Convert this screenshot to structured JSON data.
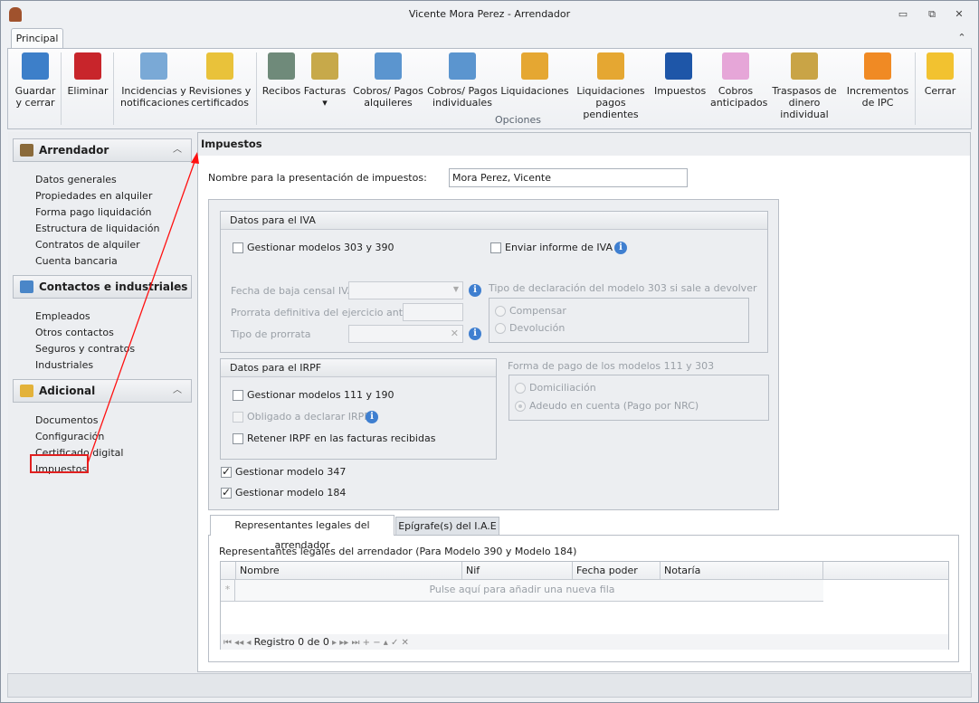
{
  "window": {
    "title": "Vicente Mora Perez - Arrendador",
    "minimize": "▭",
    "restore": "⧉",
    "close": "✕",
    "collapse": "⌃"
  },
  "ribbon": {
    "tab": "Principal",
    "group_label": "Opciones",
    "buttons": [
      {
        "l1": "Guardar",
        "l2": "y cerrar",
        "icon": "save-icon",
        "color": "#3d7fc9"
      },
      {
        "l1": "Eliminar",
        "l2": "",
        "icon": "delete-icon",
        "color": "#c8252b"
      },
      {
        "l1": "Incidencias y",
        "l2": "notificaciones",
        "icon": "incidents-icon",
        "color": "#7aa9d6"
      },
      {
        "l1": "Revisiones y",
        "l2": "certificados",
        "icon": "bell-icon",
        "color": "#e9c23a"
      },
      {
        "l1": "Recibos",
        "l2": "",
        "icon": "receipt-icon",
        "color": "#6f8a7a"
      },
      {
        "l1": "Facturas",
        "l2": "▾",
        "icon": "invoice-icon",
        "color": "#c7a94a"
      },
      {
        "l1": "Cobros/ Pagos",
        "l2": "alquileres",
        "icon": "calculator-icon",
        "color": "#5b95cf"
      },
      {
        "l1": "Cobros/ Pagos",
        "l2": "individuales",
        "icon": "calculator-person-icon",
        "color": "#5b95cf"
      },
      {
        "l1": "Liquidaciones",
        "l2": "",
        "icon": "certificate-icon",
        "color": "#e5a732"
      },
      {
        "l1": "Liquidaciones",
        "l2": "pagos pendientes",
        "icon": "certificate-icon",
        "color": "#e5a732"
      },
      {
        "l1": "Impuestos",
        "l2": "",
        "icon": "tax-agency-icon",
        "color": "#1e56a8"
      },
      {
        "l1": "Cobros",
        "l2": "anticipados",
        "icon": "piggy-bank-icon",
        "color": "#e6a6d8"
      },
      {
        "l1": "Traspasos de",
        "l2": "dinero individual",
        "icon": "transfer-icon",
        "color": "#c9a446"
      },
      {
        "l1": "Incrementos",
        "l2": "de IPC",
        "icon": "increase-icon",
        "color": "#f08a24"
      },
      {
        "l1": "Cerrar",
        "l2": "",
        "icon": "folder-exit-icon",
        "color": "#f2c230"
      }
    ]
  },
  "sidebar": {
    "groups": [
      {
        "title": "Arrendador",
        "items": [
          "Datos generales",
          "Propiedades en alquiler",
          "Forma pago liquidación",
          "Estructura de liquidación",
          "Contratos de alquiler",
          "Cuenta bancaria"
        ]
      },
      {
        "title": "Contactos e industriales",
        "items": [
          "Empleados",
          "Otros contactos",
          "Seguros y contratos",
          "Industriales"
        ]
      },
      {
        "title": "Adicional",
        "items": [
          "Documentos",
          "Configuración",
          "Certificado digital",
          "Impuestos"
        ]
      }
    ]
  },
  "main": {
    "title": "Impuestos",
    "name_label": "Nombre para la presentación de impuestos:",
    "name_value": "Mora Perez, Vicente",
    "iva": {
      "title": "Datos para el IVA",
      "gestionar": "Gestionar modelos 303 y 390",
      "enviar": "Enviar informe de IVA",
      "fecha_baja": "Fecha de baja censal IVA",
      "prorrata": "Prorrata definitiva del ejercicio anterior",
      "tipo_prorrata": "Tipo de prorrata",
      "tipo_decl": "Tipo de declaración del modelo 303 si sale a devolver",
      "compensar": "Compensar",
      "devolucion": "Devolución"
    },
    "irpf": {
      "title": "Datos para el IRPF",
      "gestionar": "Gestionar modelos 111 y 190",
      "obligado": "Obligado a declarar IRPF",
      "retener": "Retener IRPF en las facturas recibidas"
    },
    "forma_pago": {
      "title": "Forma de pago de los modelos 111 y 303",
      "domiciliacion": "Domiciliación",
      "adeudo": "Adeudo en cuenta (Pago por NRC)"
    },
    "m347": "Gestionar modelo 347",
    "m184": "Gestionar modelo 184",
    "tabs": [
      "Representantes legales del arrendador",
      "Epígrafe(s) del I.A.E"
    ],
    "grid": {
      "caption": "Representantes legales del arrendador (Para Modelo 390 y Modelo 184)",
      "columns": [
        "Nombre",
        "Nif",
        "Fecha poder",
        "Notaría"
      ],
      "new_row": "Pulse aquí para añadir una nueva fila",
      "record": "Registro 0 de 0"
    }
  }
}
